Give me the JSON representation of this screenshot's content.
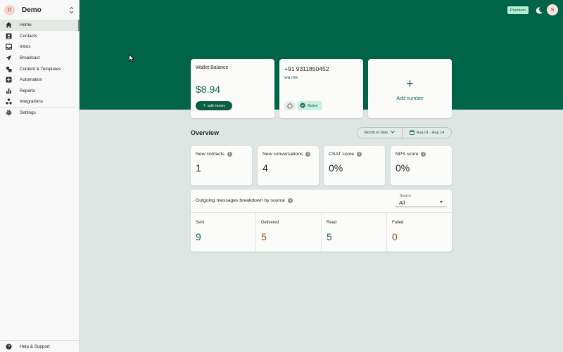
{
  "workspace": {
    "initial": "D",
    "name": "Demo"
  },
  "nav": [
    {
      "label": "Home",
      "icon": "home-icon"
    },
    {
      "label": "Contacts",
      "icon": "contacts-icon"
    },
    {
      "label": "Inbox",
      "icon": "inbox-icon"
    },
    {
      "label": "Broadcast",
      "icon": "send-icon"
    },
    {
      "label": "Content & Templates",
      "icon": "templates-icon"
    },
    {
      "label": "Automation",
      "icon": "automation-icon"
    },
    {
      "label": "Reports",
      "icon": "reports-icon"
    },
    {
      "label": "Integrations",
      "icon": "integrations-icon"
    },
    {
      "label": "Settings",
      "icon": "gear-icon"
    }
  ],
  "help_label": "Help & Support",
  "header": {
    "premium_label": "Premium",
    "user_initial": "S"
  },
  "wallet": {
    "title": "Wallet Balance",
    "amount": "$8.94",
    "button_label": "add money"
  },
  "phone": {
    "number": "+91 9311850452",
    "link": "wa.me",
    "status": "Active"
  },
  "add_number": {
    "label": "Add number"
  },
  "overview": {
    "title": "Overview",
    "period": "Month to date",
    "date_range": "Aug 01 - Aug 14"
  },
  "stats": [
    {
      "label": "New contacts",
      "value": "1"
    },
    {
      "label": "New conversations",
      "value": "4"
    },
    {
      "label": "CSAT score",
      "value": "0%"
    },
    {
      "label": "NPS score",
      "value": "0%"
    }
  ],
  "breakdown": {
    "title": "Outgoing messages breakdown by source",
    "source_label": "Source",
    "source_value": "All",
    "columns": [
      {
        "label": "Sent",
        "value": "9",
        "color": "#0f6a48"
      },
      {
        "label": "Delivered",
        "value": "5",
        "color": "#8a6a12"
      },
      {
        "label": "Read",
        "value": "5",
        "color": "#0f6a48"
      },
      {
        "label": "Failed",
        "value": "0",
        "color": "#a04a20"
      }
    ]
  },
  "colors": {
    "brand": "#006446",
    "accent": "#0f6a48"
  }
}
